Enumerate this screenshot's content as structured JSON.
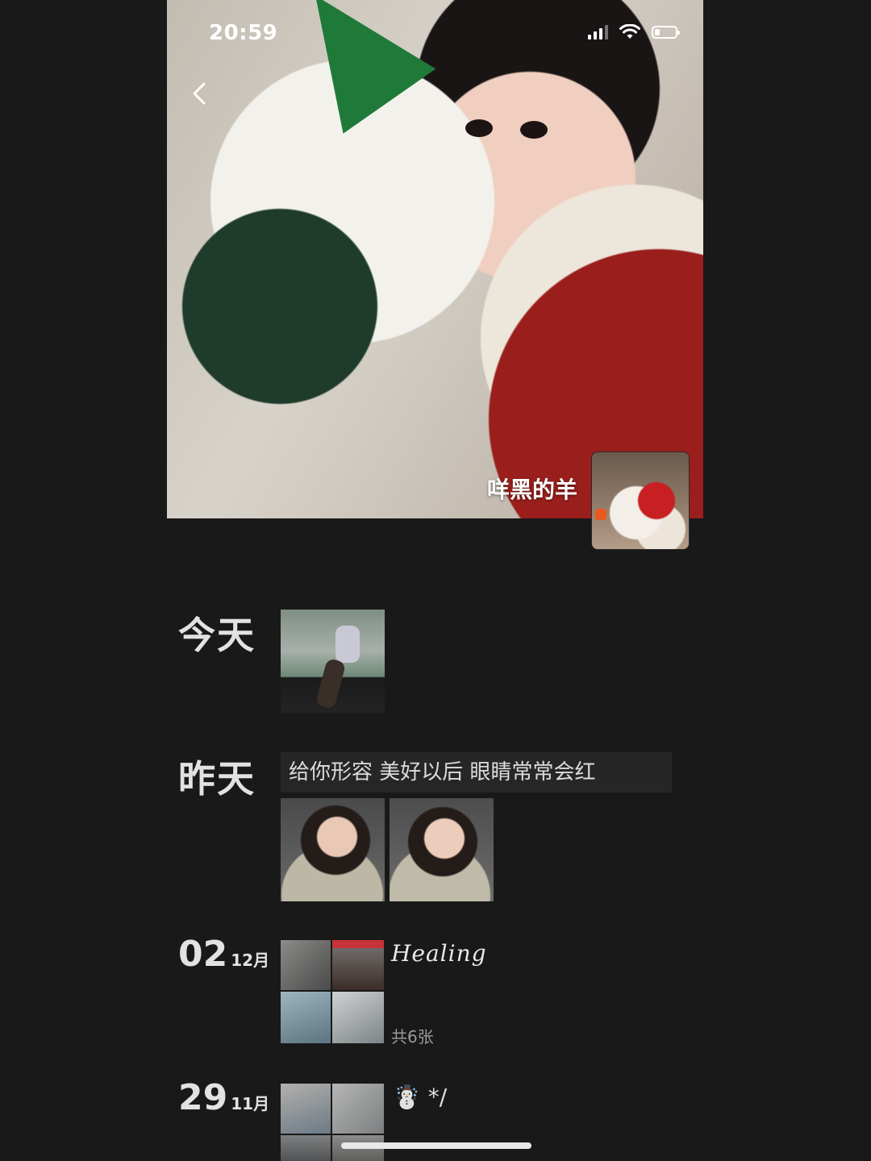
{
  "status_bar": {
    "time": "20:59",
    "icons": [
      "signal-icon",
      "wifi-icon",
      "battery-icon"
    ]
  },
  "header": {
    "back_icon": "chevron-left-icon",
    "username": "咩黑的羊"
  },
  "timeline": [
    {
      "date_label": "今天",
      "images": 1
    },
    {
      "date_label": "昨天",
      "text": "给你形容 美好以后 眼睛常常会红",
      "images": 2
    },
    {
      "day": "02",
      "month": "12月",
      "caption": "Healing",
      "count": "共6张",
      "images": 4
    },
    {
      "day": "29",
      "month": "11月",
      "caption": "☃️ */",
      "images": 4
    }
  ],
  "colors": {
    "background": "#191919",
    "text_primary": "#e2e2e2",
    "text_secondary": "#9a9a9a",
    "text_post_bg": "#262626"
  }
}
